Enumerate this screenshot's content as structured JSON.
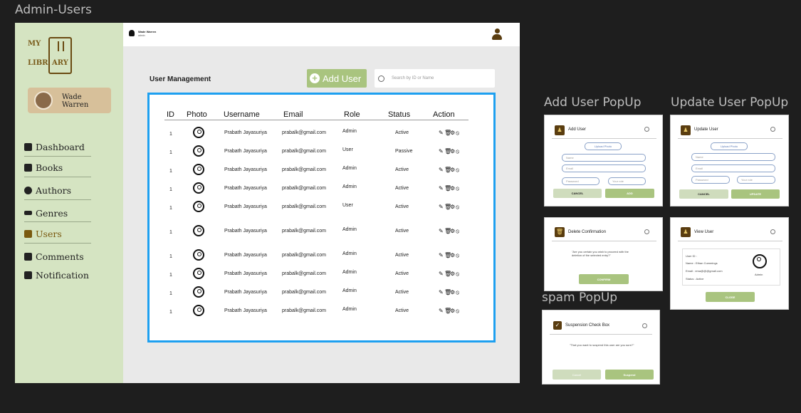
{
  "frame_labels": {
    "main": "Admin-Users",
    "add_user": "Add User PopUp",
    "update_user": "Update User PopUp",
    "spam": "spam PopUp"
  },
  "logo": {
    "l1a": "MY",
    "l2a": "LIBR",
    "l2b": "ARY"
  },
  "profile": {
    "name_line1": "Wade",
    "name_line2": "Warren"
  },
  "sidebar": {
    "items": [
      {
        "label": "Dashboard",
        "icon": "dashboard-icon"
      },
      {
        "label": "Books",
        "icon": "book-icon"
      },
      {
        "label": "Authors",
        "icon": "authors-icon"
      },
      {
        "label": "Genres",
        "icon": "list-icon"
      },
      {
        "label": "Users",
        "icon": "users-icon",
        "active": true
      },
      {
        "label": "Comments",
        "icon": "comment-icon"
      },
      {
        "label": "Notification",
        "icon": "alert-icon"
      }
    ]
  },
  "topbar": {
    "user_name": "Wade Warren",
    "user_role": "admin"
  },
  "page": {
    "title": "User Management",
    "add_button": "Add User",
    "search_placeholder": "Search by ID or Name"
  },
  "table": {
    "headers": [
      "ID",
      "Photo",
      "Username",
      "Email",
      "Role",
      "Status",
      "Action"
    ],
    "rows": [
      {
        "id": "1",
        "username": "Prabath Jayasuriya",
        "email": "prabalk@gmail.com",
        "role": "Admin",
        "status": "Active"
      },
      {
        "id": "1",
        "username": "Prabath Jayasuriya",
        "email": "prabalk@gmail.com",
        "role": "User",
        "status": "Passive"
      },
      {
        "id": "1",
        "username": "Prabath Jayasuriya",
        "email": "prabalk@gmail.com",
        "role": "Admin",
        "status": "Active"
      },
      {
        "id": "1",
        "username": "Prabath Jayasuriya",
        "email": "prabalk@gmail.com",
        "role": "Admin",
        "status": "Active"
      },
      {
        "id": "1",
        "username": "Prabath Jayasuriya",
        "email": "prabalk@gmail.com",
        "role": "User",
        "status": "Active"
      },
      {
        "id": "1",
        "username": "Prabath Jayasuriya",
        "email": "prabalk@gmail.com",
        "role": "Admin",
        "status": "Active"
      },
      {
        "id": "1",
        "username": "Prabath Jayasuriya",
        "email": "prabalk@gmail.com",
        "role": "Admin",
        "status": "Active"
      },
      {
        "id": "1",
        "username": "Prabath Jayasuriya",
        "email": "prabalk@gmail.com",
        "role": "Admin",
        "status": "Active"
      },
      {
        "id": "1",
        "username": "Prabath Jayasuriya",
        "email": "prabalk@gmail.com",
        "role": "Admin",
        "status": "Active"
      },
      {
        "id": "1",
        "username": "Prabath Jayasuriya",
        "email": "prabalk@gmail.com",
        "role": "Admin",
        "status": "Active"
      }
    ]
  },
  "popups": {
    "add": {
      "title": "Add User",
      "upload": "Upload Photo",
      "name": "Name",
      "email": "Email",
      "password": "Password",
      "role": "Your role",
      "cancel": "CANCEL",
      "confirm": "ADD"
    },
    "update": {
      "title": "Update User",
      "upload": "Upload Photo",
      "name": "Name",
      "email": "Email",
      "password": "Password",
      "role": "Your role",
      "cancel": "CANCEL",
      "confirm": "UPDATE"
    },
    "delete": {
      "title": "Delete Confirmation",
      "message": "\"Are you certain you wish to proceed with the deletion of the selected entry?\"",
      "confirm": "CONFIRM"
    },
    "view": {
      "title": "View User",
      "f1": "User ID :",
      "f2": "Name : Ethan Cummings",
      "f3": "Email : ema@@@gmail.com",
      "f4": "Status : Active",
      "role": "Admin",
      "close": "CLOSE"
    },
    "spam": {
      "title": "Suspension Check Box",
      "message": "\"That you want to suspend this user are you sure?\"",
      "cancel": "Cancel",
      "confirm": "Suspend"
    }
  }
}
